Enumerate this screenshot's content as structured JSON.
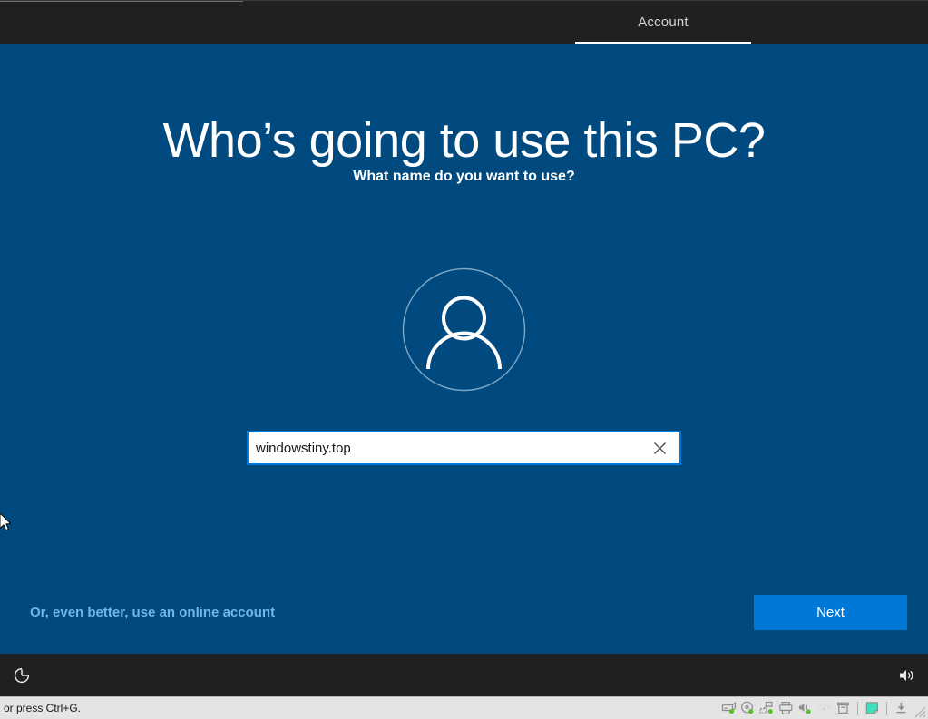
{
  "window": {
    "topbar": {
      "tab_label": "Account",
      "tab_name": "account-tab"
    },
    "colors": {
      "background_blue": "#004A7F",
      "chrome_dark": "#202020",
      "accent_blue": "#0078D7",
      "link_blue": "#6fb8e8",
      "statusbar_gray": "#e4e4e4",
      "activity_green": "#5ac02b",
      "note_teal": "#3fe0c0"
    }
  },
  "main": {
    "heading": "Who’s going to use this PC?",
    "subheading": "What name do you want to use?",
    "avatar_icon": "person-icon",
    "name_field": {
      "value": "windowstiny.top",
      "placeholder": "",
      "clear_icon": "close-icon"
    },
    "online_account_link": "Or, even better, use an online account",
    "next_button": "Next"
  },
  "footer": {
    "ease_of_access_icon": "ease-of-access-icon",
    "volume_icon": "volume-icon"
  },
  "statusbar": {
    "message": "or press Ctrl+G.",
    "icons": [
      {
        "name": "harddisk-icon",
        "active": true
      },
      {
        "name": "optical-disc-icon",
        "active": true
      },
      {
        "name": "network-icon",
        "active": true
      },
      {
        "name": "printer-icon",
        "active": true
      },
      {
        "name": "audio-icon",
        "active": true
      },
      {
        "name": "usb-icon",
        "active": false
      },
      {
        "name": "shared-folder-icon",
        "active": false
      }
    ],
    "note_icon": "note-icon",
    "download_icon": "download-icon",
    "resize_grip": "resize-grip"
  }
}
